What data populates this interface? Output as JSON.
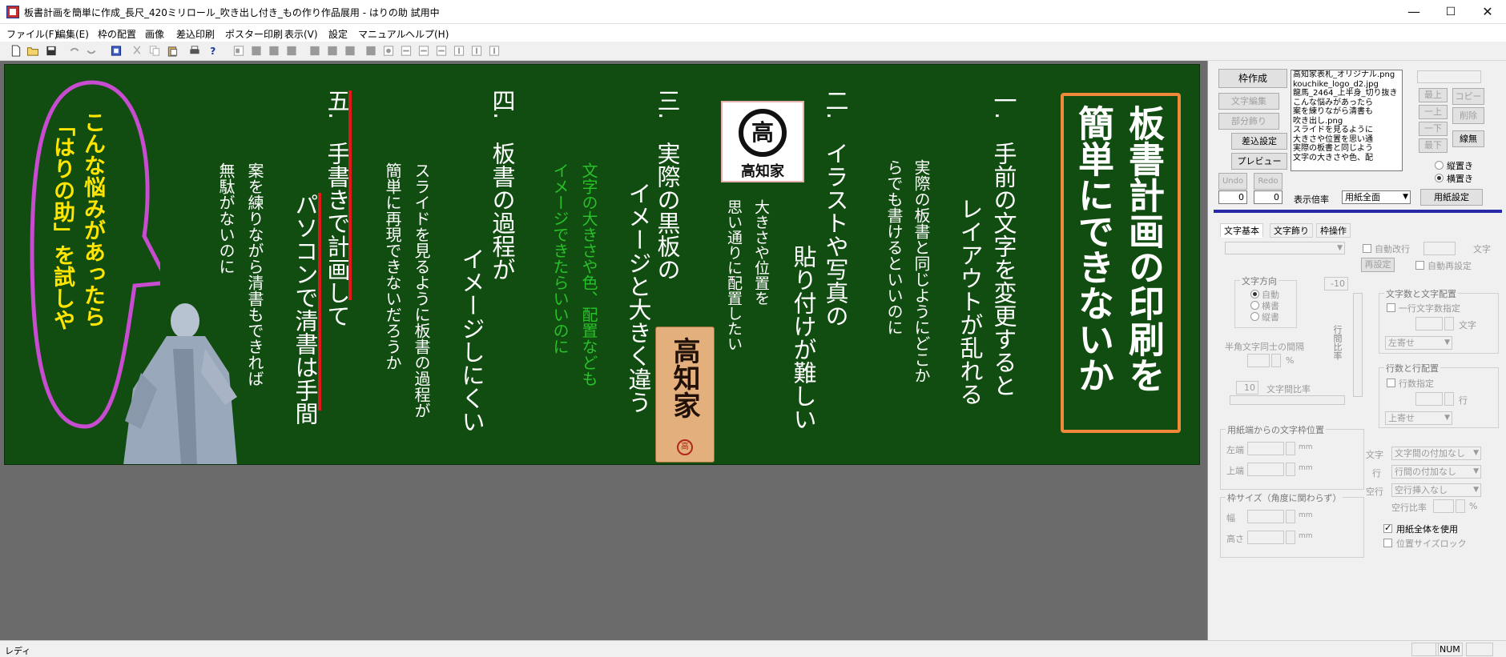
{
  "window": {
    "title": "板書計画を簡単に作成_長尺_420ミリロール_吹き出し付き_もの作り作品展用 - はりの助 試用中",
    "minimize": "—",
    "maximize": "☐",
    "close": "✕"
  },
  "menu": [
    "ファイル(F)",
    "編集(E)",
    "枠の配置",
    "画像",
    "差込印刷",
    "ポスター印刷",
    "表示(V)",
    "設定",
    "マニュアル",
    "ヘルプ(H)"
  ],
  "toolbar_icons": [
    "new-file-icon",
    "open-folder-icon",
    "save-icon",
    "undo-icon",
    "redo-icon",
    "frame-icon",
    "cut-icon",
    "copy-icon",
    "paste-icon",
    "print-icon",
    "help-icon"
  ],
  "board": {
    "headline": [
      "板書計画の印刷を",
      "簡単にできないか"
    ],
    "items": [
      {
        "number": "一.",
        "lines": [
          "手前の文字を変更すると",
          "レイアウトが乱れる"
        ],
        "note": [
          "実際の板書と同じようにどこか",
          "らでも書けるといいのに"
        ]
      },
      {
        "number": "二.",
        "lines": [
          "イラストや写真の",
          "貼り付けが難しい"
        ],
        "note": [
          "大きさや位置を",
          "思い通りに配置したい"
        ]
      },
      {
        "number": "三.",
        "lines": [
          "実際の黒板の",
          "イメージと大きく違う"
        ],
        "note": [
          "文字の大きさや色、配置なども",
          "イメージできたらいいのに"
        ]
      },
      {
        "number": "四.",
        "lines": [
          "板書の過程が",
          "イメージしにくい"
        ],
        "note": [
          "スライドを見るように板書の過程が",
          "簡単に再現できないだろうか"
        ]
      },
      {
        "number": "五.",
        "lines": [
          "手書きで計画して",
          "パソコンで清書は手間"
        ],
        "note": [
          "案を練りながら清書もできれば",
          "無駄がないのに"
        ]
      }
    ],
    "logo": {
      "mark": "高",
      "name": "高知家"
    },
    "wood_label": "高知家",
    "wood_seal": "高",
    "bubble": [
      "こんな悩みがあったら",
      "「はりの助」を試しや"
    ],
    "colors": {
      "board": "#114d11",
      "accent_orange": "#f08a3a",
      "red": "#e01818",
      "green_text": "#29c029",
      "bubble_text": "#ffe500",
      "bubble_border": "#c74ccf"
    }
  },
  "panel": {
    "buttons": {
      "frame_create": "枠作成",
      "text_edit": "文字編集",
      "partial_decor": "部分飾り",
      "merge_settings": "差込設定",
      "preview": "プレビュー",
      "undo": "Undo",
      "redo": "Redo",
      "front": "最上",
      "up": "一上",
      "down": "一下",
      "back": "最下",
      "copy": "コピー",
      "delete": "削除",
      "border_none": "線無",
      "paper_settings": "用紙設定",
      "reset1": "再設定"
    },
    "file_list": [
      "高知家表札_オリジナル.png",
      "kouchike_logo_d2.jpg",
      "龍馬_2464_上半身_切り抜き",
      "こんな悩みがあったら",
      "案を練りながら清書も",
      "吹き出し.png",
      "スライドを見るように",
      "大きさや位置を思い通",
      "実際の板書と同じよう",
      "文字の大きさや色、配"
    ],
    "undo_count": "0",
    "redo_count": "0",
    "zoom_label": "表示倍率",
    "zoom_value": "用紙全面",
    "orientation": {
      "vertical": "縦置き",
      "horizontal": "横置き"
    },
    "tabs": [
      "文字基本",
      "文字飾り",
      "枠操作"
    ],
    "auto_wrap": "自動改行",
    "char_unit": "文字",
    "auto_reset": "自動再設定",
    "text_direction": {
      "caption": "文字方向",
      "auto": "自動",
      "horizontal": "横書",
      "vertical": "縦書"
    },
    "line_spacing_value": "-10",
    "line_spacing_label": "行間比率",
    "halfwidth_gap_label": "半角文字同士の間隔",
    "percent": "%",
    "char_spacing_value": "10",
    "char_spacing_label": "文字間比率",
    "char_count_group": "文字数と文字配置",
    "one_line_count": "一行文字数指定",
    "char_unit2": "文字",
    "align_left": "左寄せ",
    "line_group": "行数と行配置",
    "line_count": "行数指定",
    "line_unit": "行",
    "align_top": "上寄せ",
    "position_group": "用紙端からの文字枠位置",
    "left_edge": "左端",
    "top_edge": "上端",
    "mm": "mm",
    "size_group": "枠サイズ（角度に関わらず）",
    "width": "幅",
    "height": "高さ",
    "char_row_label": "文字",
    "char_row_value": "文字間の付加なし",
    "line_row_label": "行",
    "line_row_value": "行間の付加なし",
    "blank_row_label": "空行",
    "blank_row_value": "空行挿入なし",
    "blank_ratio": "空行比率",
    "use_whole_paper": "用紙全体を使用",
    "lock_position": "位置サイズロック"
  },
  "status": {
    "ready": "レディ",
    "num": "NUM"
  }
}
